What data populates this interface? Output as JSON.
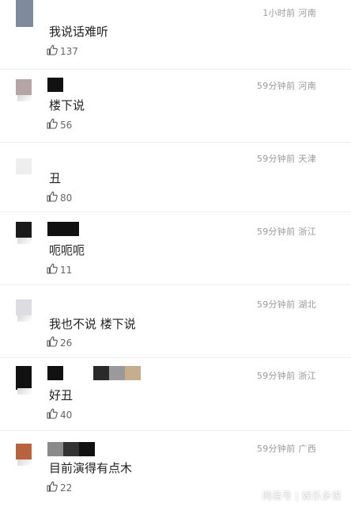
{
  "comments": [
    {
      "time": "1小时前",
      "location": "河南",
      "text": "我说话难听",
      "likes": "137"
    },
    {
      "time": "59分钟前",
      "location": "河南",
      "text": "楼下说",
      "likes": "56"
    },
    {
      "time": "59分钟前",
      "location": "天津",
      "text": "丑",
      "likes": "80"
    },
    {
      "time": "59分钟前",
      "location": "浙江",
      "text": "呃呃呃",
      "likes": "11"
    },
    {
      "time": "59分钟前",
      "location": "湖北",
      "text": "我也不说 楼下说",
      "likes": "26"
    },
    {
      "time": "59分钟前",
      "location": "浙江",
      "text": "好丑",
      "likes": "40"
    },
    {
      "time": "59分钟前",
      "location": "广西",
      "text": "目前演得有点木",
      "likes": "22"
    }
  ],
  "watermark": {
    "brand": "网易号",
    "account": "娱乐多谋"
  },
  "icons": {
    "like": "thumbs-up-icon"
  }
}
